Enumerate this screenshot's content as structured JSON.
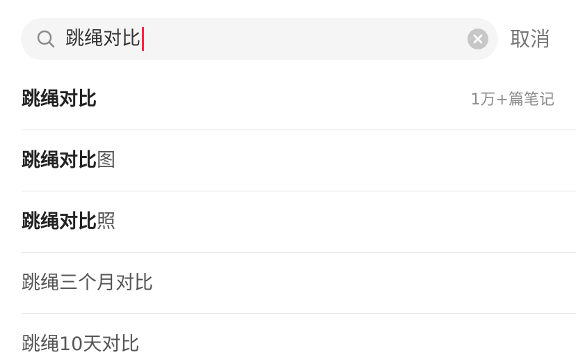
{
  "search": {
    "query": "跳绳对比",
    "cancel_label": "取消",
    "colors": {
      "accent": "#ff2442",
      "field_background": "#f5f5f5"
    },
    "icons": {
      "search": "search-icon",
      "clear": "clear-icon"
    }
  },
  "suggestions": [
    {
      "bold": "跳绳对比",
      "rest": "",
      "count": "1万+篇笔记"
    },
    {
      "bold": "跳绳对比",
      "rest": "图",
      "count": ""
    },
    {
      "bold": "跳绳对比",
      "rest": "照",
      "count": ""
    },
    {
      "bold": "",
      "rest": "跳绳三个月对比",
      "count": ""
    },
    {
      "bold": "",
      "rest": "跳绳10天对比",
      "count": ""
    }
  ]
}
